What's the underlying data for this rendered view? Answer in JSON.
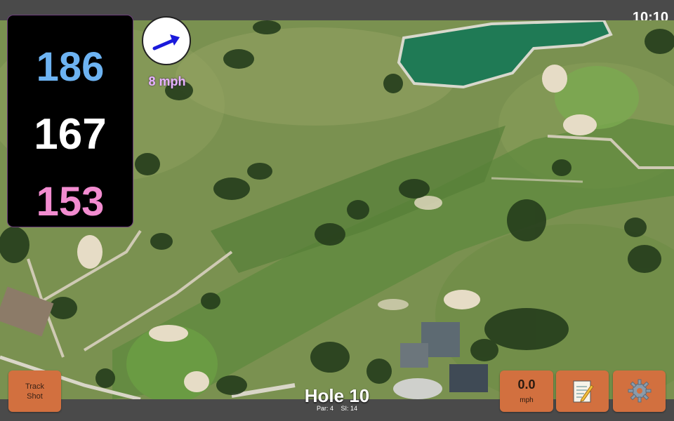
{
  "status": {
    "time": "10:10"
  },
  "distances": {
    "back": "186",
    "middle": "167",
    "front": "153"
  },
  "wind": {
    "speed_label": "8 mph",
    "direction_icon": "arrow-icon"
  },
  "buttons": {
    "track_shot": "Track\nShot",
    "wind_value": "0.0",
    "wind_unit": "mph",
    "notes_icon": "notepad-icon",
    "settings_icon": "gear-icon"
  },
  "hole": {
    "title": "Hole 10",
    "par": "Par: 4",
    "si": "SI: 14"
  },
  "colors": {
    "back": "#6db3f2",
    "middle": "#ffffff",
    "front": "#f28cd0",
    "button": "#d2703f",
    "wind_text": "#e7b3ff"
  }
}
